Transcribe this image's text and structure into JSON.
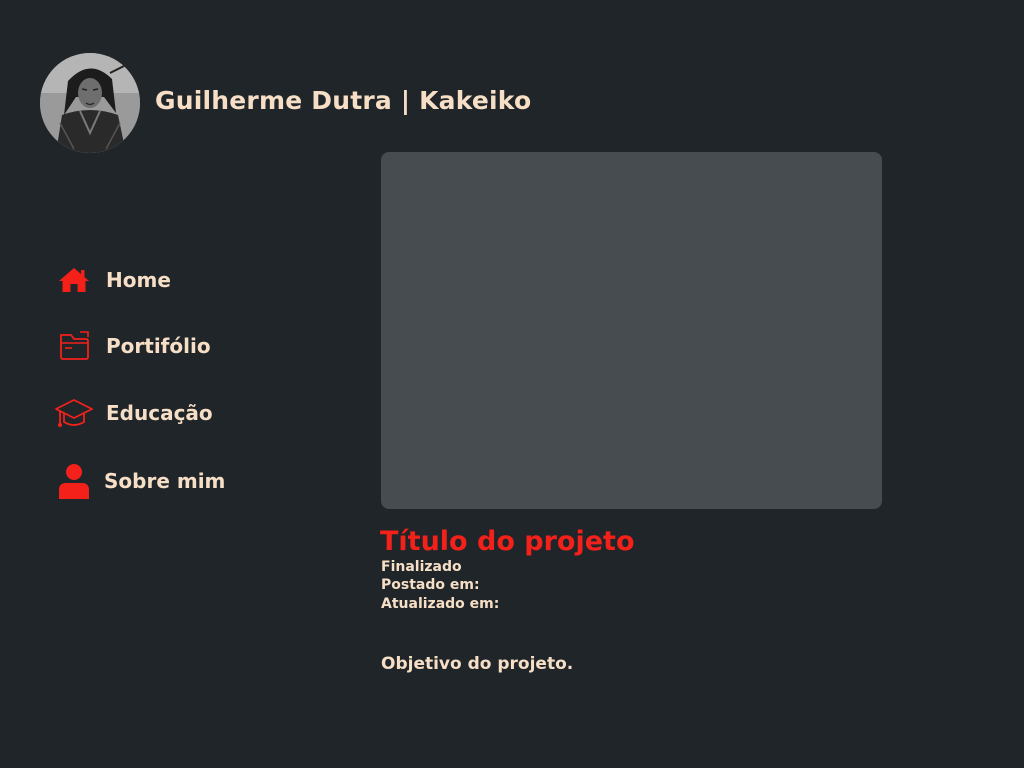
{
  "header": {
    "title": "Guilherme Dutra | Kakeiko"
  },
  "nav": {
    "items": [
      {
        "label": "Home",
        "icon": "home-icon"
      },
      {
        "label": "Portifólio",
        "icon": "folder-icon"
      },
      {
        "label": "Educação",
        "icon": "graduation-cap-icon"
      },
      {
        "label": "Sobre mim",
        "icon": "user-icon"
      }
    ]
  },
  "project": {
    "title": "Título do projeto",
    "status": "Finalizado",
    "posted_label": "Postado em:",
    "updated_label": "Atualizado em:",
    "objective": "Objetivo do projeto."
  },
  "colors": {
    "background": "#1f2528",
    "accent": "#f3211a",
    "text": "#f6dfc6",
    "placeholder": "#474c50"
  }
}
